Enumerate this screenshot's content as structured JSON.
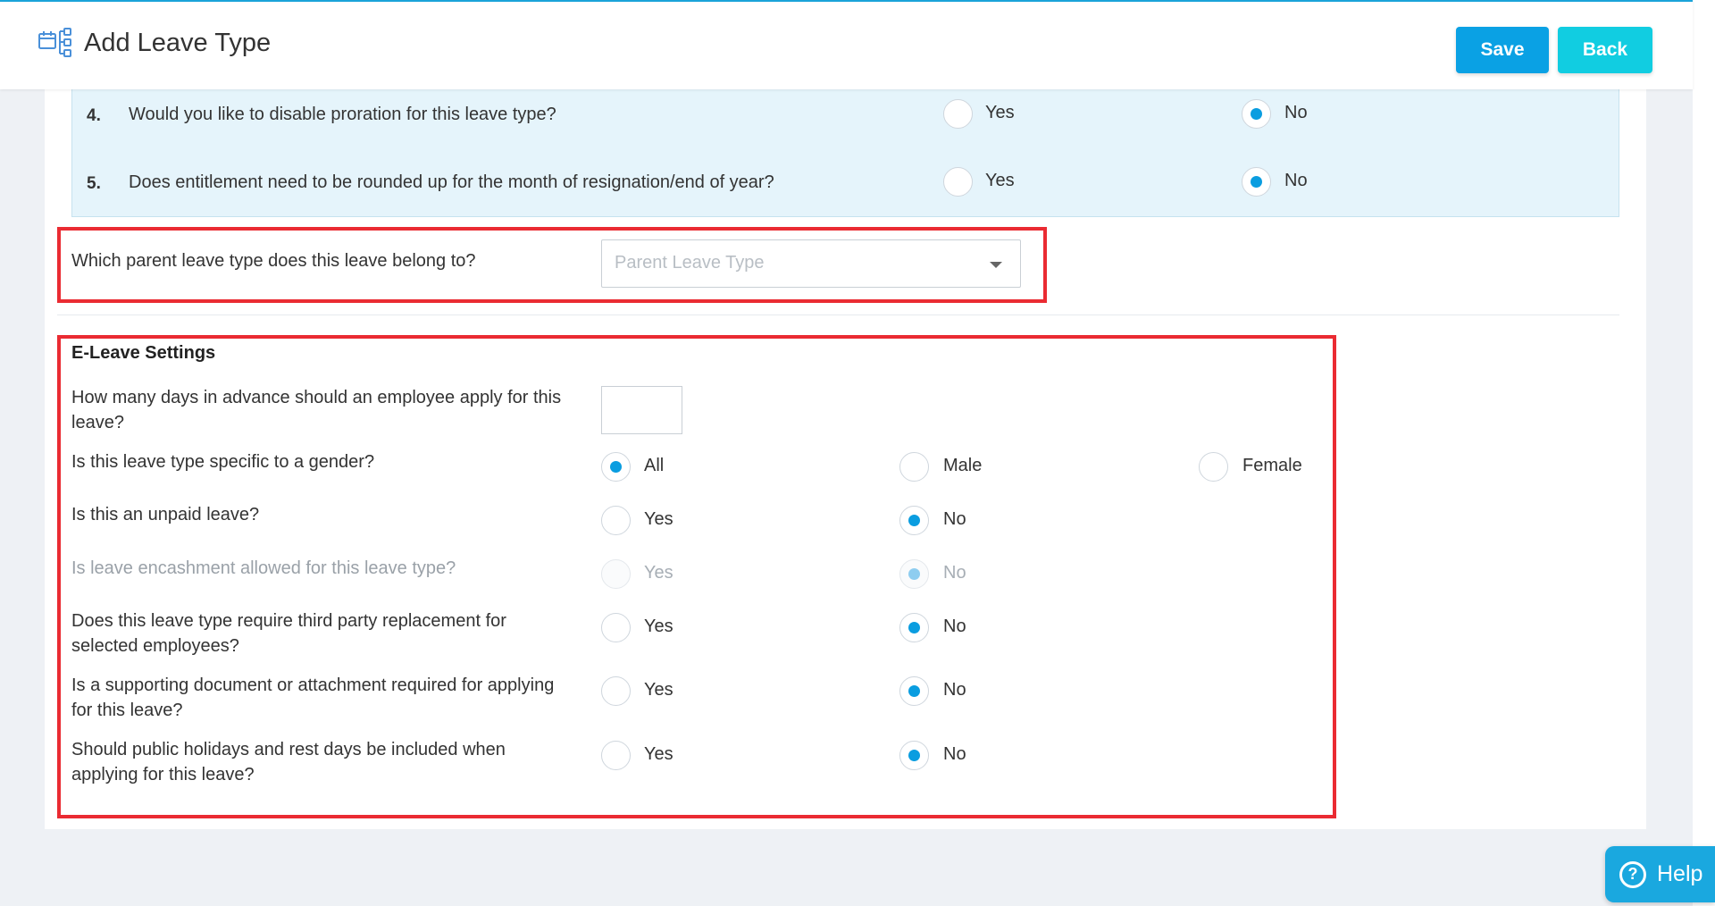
{
  "header": {
    "title": "Add Leave Type",
    "icon": "leave-type-hierarchy-icon",
    "save_label": "Save",
    "back_label": "Back"
  },
  "questions": [
    {
      "num": "4.",
      "text": "Would you like to disable proration for this leave type?",
      "yes": "Yes",
      "no": "No",
      "selected": "No"
    },
    {
      "num": "5.",
      "text": "Does entitlement need to be rounded up for the month of resignation/end of year?",
      "yes": "Yes",
      "no": "No",
      "selected": "No"
    }
  ],
  "parent": {
    "label": "Which parent leave type does this leave belong to?",
    "placeholder": "Parent Leave Type"
  },
  "eleave": {
    "title": "E-Leave Settings",
    "advance_label": "How many days in advance should an employee apply for this leave?",
    "advance_value": "",
    "gender": {
      "label": "Is this leave type specific to a gender?",
      "options": [
        "All",
        "Male",
        "Female"
      ],
      "selected": "All"
    },
    "rows": [
      {
        "label": "Is this an unpaid leave?",
        "yes": "Yes",
        "no": "No",
        "selected": "No",
        "disabled": false
      },
      {
        "label": "Is leave encashment allowed for this leave type?",
        "yes": "Yes",
        "no": "No",
        "selected": "No",
        "disabled": true
      },
      {
        "label": "Does this leave type require third party replacement for selected employees?",
        "yes": "Yes",
        "no": "No",
        "selected": "No",
        "disabled": false
      },
      {
        "label": "Is a supporting document or attachment required for applying for this leave?",
        "yes": "Yes",
        "no": "No",
        "selected": "No",
        "disabled": false
      },
      {
        "label": "Should public holidays and rest days be included when applying for this leave?",
        "yes": "Yes",
        "no": "No",
        "selected": "No",
        "disabled": false
      }
    ]
  },
  "help": {
    "label": "Help"
  },
  "colors": {
    "accent": "#0a9de0",
    "highlight": "#ea2b32",
    "back_button": "#11cde1"
  }
}
